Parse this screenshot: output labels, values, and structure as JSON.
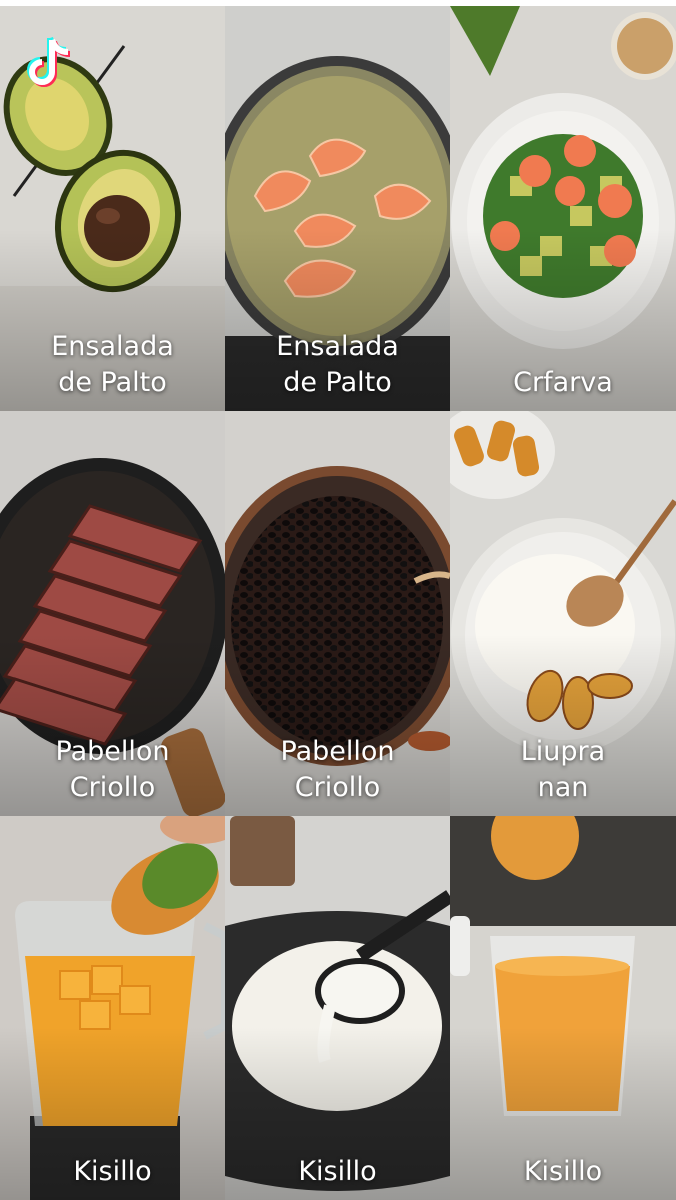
{
  "app": {
    "logo": "tiktok-logo-icon"
  },
  "tiles": [
    {
      "row": 1,
      "col": 1,
      "image": "halved-avocado",
      "caption": [
        "Ensalada",
        "de Palto"
      ]
    },
    {
      "row": 1,
      "col": 2,
      "image": "shrimp-boiling-in-pot",
      "caption": [
        "Ensalada",
        "de Palto"
      ]
    },
    {
      "row": 1,
      "col": 3,
      "image": "shrimp-avocado-salad",
      "caption": [
        "Crfarva"
      ]
    },
    {
      "row": 2,
      "col": 1,
      "image": "steak-in-skillet",
      "caption": [
        "Pabellon",
        "Criollo"
      ]
    },
    {
      "row": 2,
      "col": 2,
      "image": "black-beans-in-pot",
      "caption": [
        "Pabellon",
        "Criollo"
      ]
    },
    {
      "row": 2,
      "col": 3,
      "image": "rice-with-fried-plantains",
      "caption": [
        "Liupra",
        "nan"
      ]
    },
    {
      "row": 3,
      "col": 1,
      "image": "mango-in-blender",
      "caption": [
        "Kisillo"
      ]
    },
    {
      "row": 3,
      "col": 2,
      "image": "cream-in-pot-with-ladle",
      "caption": [
        "Kisillo"
      ]
    },
    {
      "row": 3,
      "col": 3,
      "image": "glass-of-mango-juice",
      "caption": [
        "Kisillo"
      ]
    }
  ]
}
